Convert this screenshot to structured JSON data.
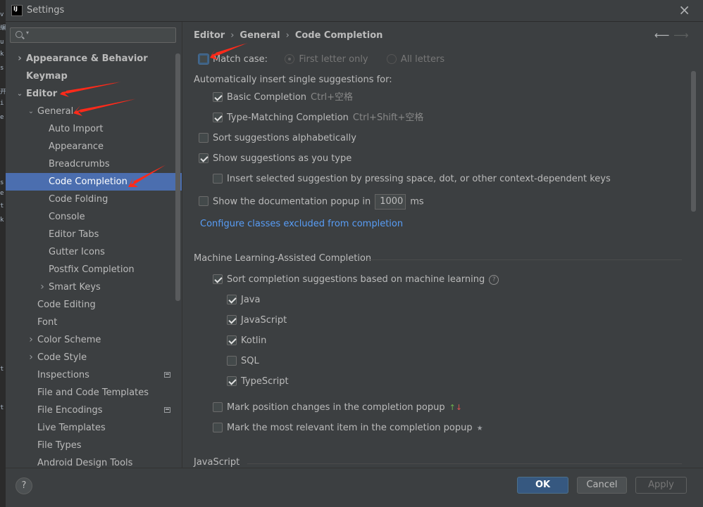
{
  "window": {
    "title": "Settings"
  },
  "search": {
    "placeholder": ""
  },
  "bg_strip": [
    "v",
    "编",
    "u",
    "k",
    "s",
    "",
    "开",
    "i",
    "e",
    "",
    "",
    "s",
    "e",
    "t",
    "k",
    "t",
    "t"
  ],
  "sidebar": {
    "items": [
      {
        "label": "Appearance & Behavior",
        "bold": true,
        "indent": 0,
        "arrow": "right"
      },
      {
        "label": "Keymap",
        "bold": true,
        "indent": 0,
        "arrow": ""
      },
      {
        "label": "Editor",
        "bold": true,
        "indent": 0,
        "arrow": "down"
      },
      {
        "label": "General",
        "bold": false,
        "indent": 1,
        "arrow": "down"
      },
      {
        "label": "Auto Import",
        "bold": false,
        "indent": 2,
        "arrow": ""
      },
      {
        "label": "Appearance",
        "bold": false,
        "indent": 2,
        "arrow": ""
      },
      {
        "label": "Breadcrumbs",
        "bold": false,
        "indent": 2,
        "arrow": ""
      },
      {
        "label": "Code Completion",
        "bold": false,
        "indent": 2,
        "arrow": "",
        "selected": true
      },
      {
        "label": "Code Folding",
        "bold": false,
        "indent": 2,
        "arrow": ""
      },
      {
        "label": "Console",
        "bold": false,
        "indent": 2,
        "arrow": ""
      },
      {
        "label": "Editor Tabs",
        "bold": false,
        "indent": 2,
        "arrow": ""
      },
      {
        "label": "Gutter Icons",
        "bold": false,
        "indent": 2,
        "arrow": ""
      },
      {
        "label": "Postfix Completion",
        "bold": false,
        "indent": 2,
        "arrow": ""
      },
      {
        "label": "Smart Keys",
        "bold": false,
        "indent": 2,
        "arrow": "right"
      },
      {
        "label": "Code Editing",
        "bold": false,
        "indent": 1,
        "arrow": ""
      },
      {
        "label": "Font",
        "bold": false,
        "indent": 1,
        "arrow": ""
      },
      {
        "label": "Color Scheme",
        "bold": false,
        "indent": 1,
        "arrow": "right"
      },
      {
        "label": "Code Style",
        "bold": false,
        "indent": 1,
        "arrow": "right"
      },
      {
        "label": "Inspections",
        "bold": false,
        "indent": 1,
        "arrow": "",
        "project_icon": true
      },
      {
        "label": "File and Code Templates",
        "bold": false,
        "indent": 1,
        "arrow": ""
      },
      {
        "label": "File Encodings",
        "bold": false,
        "indent": 1,
        "arrow": "",
        "project_icon": true
      },
      {
        "label": "Live Templates",
        "bold": false,
        "indent": 1,
        "arrow": ""
      },
      {
        "label": "File Types",
        "bold": false,
        "indent": 1,
        "arrow": ""
      },
      {
        "label": "Android Design Tools",
        "bold": false,
        "indent": 1,
        "arrow": ""
      }
    ]
  },
  "breadcrumb": [
    "Editor",
    "General",
    "Code Completion"
  ],
  "options": {
    "match_case": {
      "label": "Match case:",
      "checked": false
    },
    "first_letter_only": "First letter only",
    "all_letters": "All letters",
    "auto_insert_heading": "Automatically insert single suggestions for:",
    "basic_completion": {
      "label": "Basic Completion",
      "shortcut": "Ctrl+空格",
      "checked": true
    },
    "type_matching": {
      "label": "Type-Matching Completion",
      "shortcut": "Ctrl+Shift+空格",
      "checked": true
    },
    "sort_alpha": {
      "label": "Sort suggestions alphabetically",
      "checked": false
    },
    "show_as_type": {
      "label": "Show suggestions as you type",
      "checked": true
    },
    "insert_selected": {
      "label": "Insert selected suggestion by pressing space, dot, or other context-dependent keys",
      "checked": false
    },
    "doc_popup": {
      "label": "Show the documentation popup in",
      "value": "1000",
      "unit": "ms",
      "checked": false
    },
    "configure_link": "Configure classes excluded from completion"
  },
  "ml_section": {
    "title": "Machine Learning-Assisted Completion",
    "sort_ml": {
      "label": "Sort completion suggestions based on machine learning",
      "checked": true
    },
    "languages": [
      {
        "label": "Java",
        "checked": true
      },
      {
        "label": "JavaScript",
        "checked": true
      },
      {
        "label": "Kotlin",
        "checked": true
      },
      {
        "label": "SQL",
        "checked": false
      },
      {
        "label": "TypeScript",
        "checked": true
      }
    ],
    "mark_position": {
      "label": "Mark position changes in the completion popup",
      "checked": false
    },
    "mark_relevant": {
      "label": "Mark the most relevant item in the completion popup",
      "checked": false
    }
  },
  "js_section": {
    "title": "JavaScript"
  },
  "footer": {
    "help": "?",
    "ok": "OK",
    "cancel": "Cancel",
    "apply": "Apply"
  },
  "colors": {
    "selection": "#4b6eaf",
    "link": "#589df6",
    "ok_button": "#365880",
    "annotation": "#ff2a1a"
  }
}
